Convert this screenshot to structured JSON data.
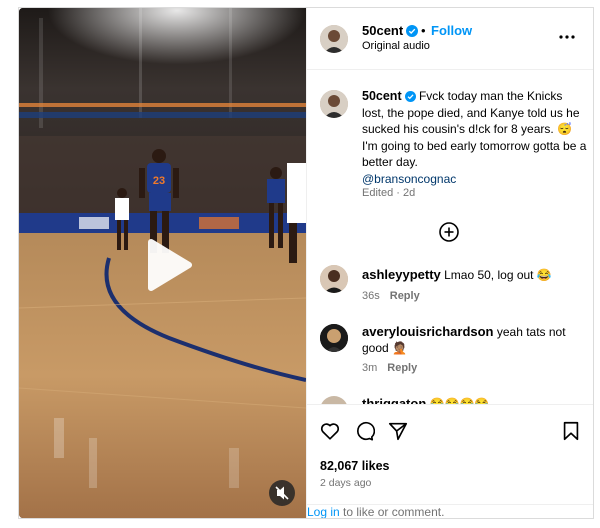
{
  "post": {
    "username": "50cent",
    "follow_label": "Follow",
    "dot": "•",
    "audio": "Original audio",
    "more_icon": "more-options-icon",
    "verified_color": "#0095f6"
  },
  "video": {
    "jersey_number": "23",
    "play_icon": "play-icon",
    "mute_icon": "muted-speaker-icon"
  },
  "caption": {
    "username": "50cent",
    "text": "Fvck today man the Knicks lost, the pope died, and Kanye told us he sucked his cousin's d!ck for 8 years. 😴I'm going to bed early tomorrow gotta be a better day.",
    "mention": "@bransoncognac",
    "meta": "Edited · 2d"
  },
  "load_more_icon": "plus-circle-icon",
  "comments": [
    {
      "username": "ashleyypetty",
      "text": "Lmao 50, log out 😂",
      "time": "36s",
      "reply": "Reply"
    },
    {
      "username": "averylouisrichardson",
      "text": "yeah tats not good 🤦🏽",
      "time": "3m",
      "reply": "Reply"
    },
    {
      "username": "thriggaton",
      "text": "😂😂😂😂"
    }
  ],
  "actions": {
    "likes": "82,067 likes",
    "time_ago": "2 days ago",
    "login_link": "Log in",
    "login_rest": " to like or comment."
  }
}
